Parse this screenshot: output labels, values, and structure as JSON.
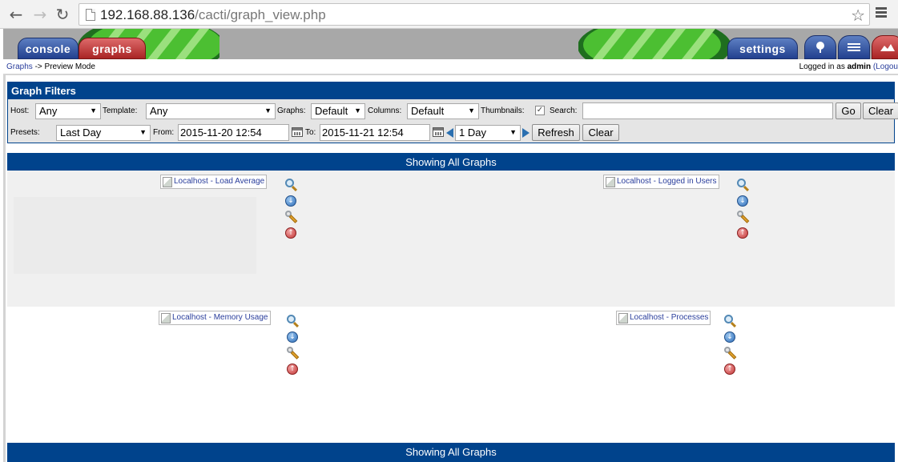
{
  "browser": {
    "url_host": "192.168.88.136",
    "url_path": "/cacti/graph_view.php"
  },
  "header": {
    "tabs": {
      "console": "console",
      "graphs": "graphs",
      "settings": "settings"
    },
    "breadcrumb": {
      "link": "Graphs",
      "separator": " -> ",
      "current": "Preview Mode"
    },
    "login": {
      "prefix": "Logged in as ",
      "user": "admin",
      "logout": "(Logou"
    }
  },
  "filters": {
    "title": "Graph Filters",
    "host_label": "Host:",
    "host_value": "Any",
    "template_label": "Template:",
    "template_value": "Any",
    "graphs_label": "Graphs:",
    "graphs_value": "Default",
    "columns_label": "Columns:",
    "columns_value": "Default",
    "thumbnails_label": "Thumbnails:",
    "thumbnails_checked": "✓",
    "search_label": "Search:",
    "search_value": "",
    "go_button": "Go",
    "clear_button_top": "Clear",
    "presets_label": "Presets:",
    "presets_value": "Last Day",
    "from_label": "From:",
    "from_value": "2015-11-20 12:54",
    "to_label": "To:",
    "to_value": "2015-11-21 12:54",
    "span_value": "1 Day",
    "refresh_button": "Refresh",
    "clear_button": "Clear"
  },
  "graph_section": {
    "title": "Showing All Graphs",
    "footer_title": "Showing All Graphs",
    "graphs": [
      {
        "title": "Localhost - Load Average"
      },
      {
        "title": "Localhost - Logged in Users"
      },
      {
        "title": "Localhost - Memory Usage"
      },
      {
        "title": "Localhost - Processes"
      }
    ]
  },
  "colors": {
    "filter_header": "#00438c",
    "tab_blue": "#22408f",
    "tab_red": "#a92424",
    "header_gray": "#a8a8a8",
    "link": "#2a3e9c"
  },
  "icons": {
    "back": "back-arrow-icon",
    "forward": "forward-arrow-icon",
    "reload": "reload-icon",
    "bookmark": "star-icon",
    "menu": "hamburger-menu-icon",
    "zoom": "magnifier-icon",
    "export": "download-icon",
    "edit": "wrench-icon",
    "move_up": "up-arrow-icon"
  }
}
